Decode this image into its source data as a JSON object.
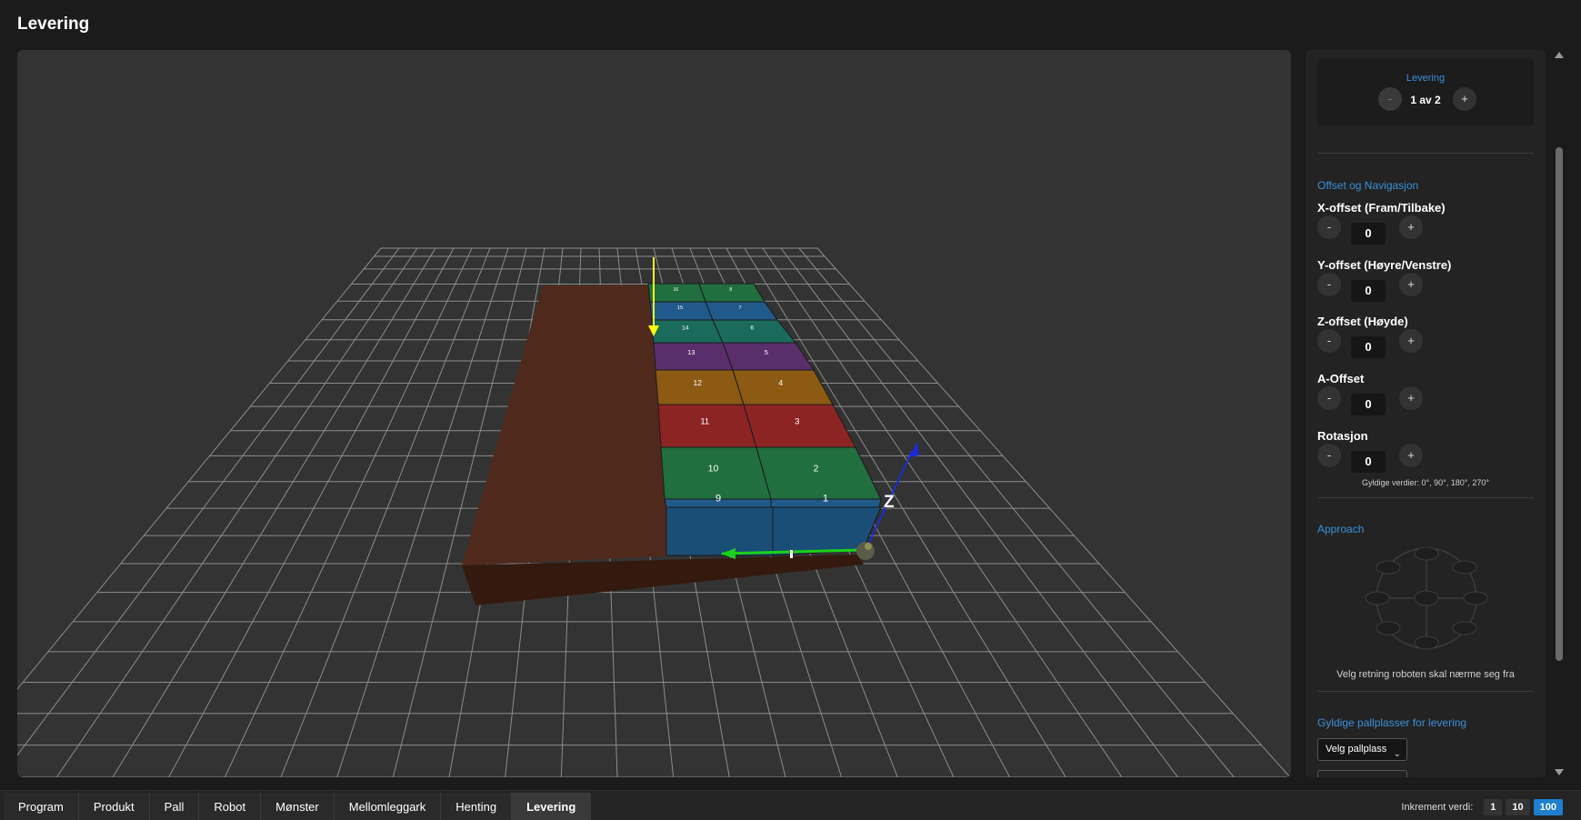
{
  "page": {
    "title": "Levering"
  },
  "scene": {
    "axis_label": "Z",
    "boxes": [
      "1",
      "2",
      "3",
      "4",
      "5",
      "6",
      "7",
      "8",
      "9",
      "10",
      "11",
      "12",
      "13",
      "14",
      "15",
      "16"
    ]
  },
  "panel": {
    "delivery": {
      "label": "Levering",
      "minus": "-",
      "plus": "+",
      "counter": "1 av 2"
    },
    "offset_section": "Offset og Navigasjon",
    "fields": [
      {
        "label": "X-offset (Fram/Tilbake)",
        "value": "0"
      },
      {
        "label": "Y-offset (Høyre/Venstre)",
        "value": "0"
      },
      {
        "label": "Z-offset (Høyde)",
        "value": "0"
      },
      {
        "label": "A-Offset",
        "value": "0"
      },
      {
        "label": "Rotasjon",
        "value": "0"
      }
    ],
    "minus": "-",
    "plus": "+",
    "rotation_hint": "Gyldige verdier: 0°, 90°, 180°, 270°",
    "approach_section": "Approach",
    "approach_hint": "Velg retning roboten skal nærme seg fra",
    "pallet_section": "Gyldige pallplasser for levering",
    "pallet_select": "Velg pallplass"
  },
  "tabs": [
    {
      "label": "Program",
      "active": false
    },
    {
      "label": "Produkt",
      "active": false
    },
    {
      "label": "Pall",
      "active": false
    },
    {
      "label": "Robot",
      "active": false
    },
    {
      "label": "Mønster",
      "active": false
    },
    {
      "label": "Mellomleggark",
      "active": false
    },
    {
      "label": "Henting",
      "active": false
    },
    {
      "label": "Levering",
      "active": true
    }
  ],
  "increment": {
    "label": "Inkrement verdi:",
    "options": [
      {
        "label": "1",
        "active": false
      },
      {
        "label": "10",
        "active": false
      },
      {
        "label": "100",
        "active": true
      }
    ]
  },
  "colors": {
    "accent": "#3a8fd8",
    "active_increment": "#1f7ecf",
    "pallet": "#4e2a1d"
  }
}
